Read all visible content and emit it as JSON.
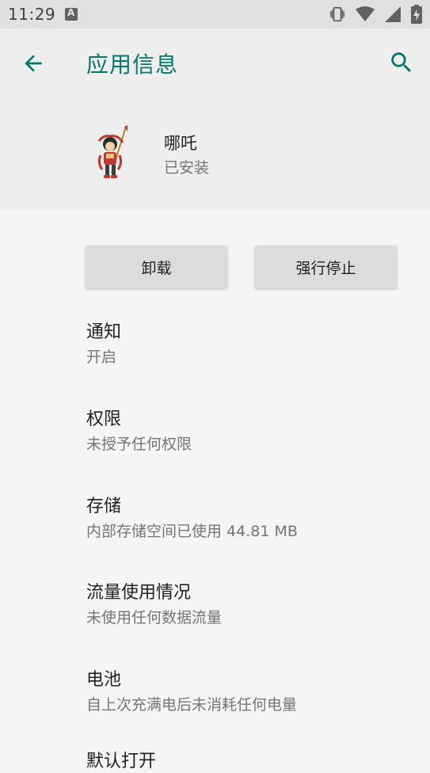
{
  "status_bar": {
    "time": "11:29",
    "notification_icon": "a-letter-icon",
    "icons": [
      "vibrate-icon",
      "wifi-icon",
      "cell-signal-icon",
      "battery-charging-icon"
    ]
  },
  "header": {
    "title": "应用信息",
    "back_icon": "arrow-back-icon",
    "search_icon": "search-icon",
    "accent_color": "#00796b"
  },
  "app": {
    "name": "哪吒",
    "status": "已安装"
  },
  "buttons": {
    "uninstall": "卸载",
    "force_stop": "强行停止"
  },
  "settings": [
    {
      "title": "通知",
      "summary": "开启"
    },
    {
      "title": "权限",
      "summary": "未授予任何权限"
    },
    {
      "title": "存储",
      "summary": "内部存储空间已使用 44.81 MB"
    },
    {
      "title": "流量使用情况",
      "summary": "未使用任何数据流量"
    },
    {
      "title": "电池",
      "summary": "自上次充满电后未消耗任何电量"
    },
    {
      "title": "默认打开",
      "summary": ""
    }
  ]
}
